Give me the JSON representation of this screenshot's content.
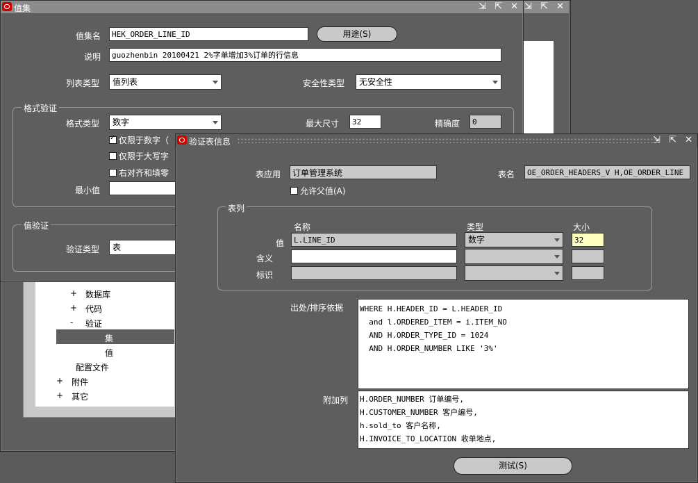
{
  "bg_window": {
    "controls": "⇲ ⇱ ✕"
  },
  "valueset": {
    "title": "值集",
    "controls": "⇲ ⇱ ✕",
    "name_label": "值集名",
    "name_value": "HEK_ORDER_LINE_ID",
    "usage_button": "用途(S)",
    "desc_label": "说明",
    "desc_value": "guozhenbin 20100421 2%字单增加3%订单的行信息",
    "list_type_label": "列表类型",
    "list_type_value": "值列表",
    "security_label": "安全性类型",
    "security_value": "无安全性",
    "format_group": "格式验证",
    "format_type_label": "格式类型",
    "format_type_value": "数字",
    "max_size_label": "最大尺寸",
    "max_size_value": "32",
    "precision_label": "精确度",
    "precision_value": "0",
    "chk_numbers_only": "仅限于数字（",
    "chk_uppercase": "仅限于大写字",
    "chk_right_justify": "右对齐和填零",
    "min_label": "最小值",
    "value_group": "值验证",
    "validation_type_label": "验证类型",
    "validation_type_value": "表"
  },
  "tree": {
    "items": [
      "数据库",
      "代码",
      "验证",
      "集",
      "值",
      "配置文件",
      "附件",
      "其它"
    ],
    "expanders": [
      "+",
      "+",
      "-",
      "+",
      "+"
    ]
  },
  "tableinfo": {
    "title": "验证表信息",
    "controls": "⇲ ⇱ ✕",
    "app_label": "表应用",
    "app_value": "订单管理系统",
    "table_label": "表名",
    "table_value": "OE_ORDER_HEADERS_V H,OE_ORDER_LINE",
    "allow_parent": "允许父值(A)",
    "columns_group": "表列",
    "col_name_header": "名称",
    "col_type_header": "类型",
    "col_size_header": "大小",
    "row_value_label": "值",
    "row_value_name": "L.LINE_ID",
    "row_value_type": "数字",
    "row_value_size": "32",
    "row_meaning_label": "含义",
    "row_id_label": "标识",
    "where_label": "出处/排序依据",
    "where_lines": [
      "WHERE H.HEADER_ID = L.HEADER_ID",
      "  and l.ORDERED_ITEM = i.ITEM_NO",
      "  AND H.ORDER_TYPE_ID = 1024",
      "  AND H.ORDER_NUMBER LIKE '3%'"
    ],
    "extra_label": "附加列",
    "extra_lines": [
      "H.ORDER_NUMBER 订单编号,",
      "H.CUSTOMER_NUMBER 客户编号,",
      "h.sold_to 客户名称,",
      "H.INVOICE_TO_LOCATION 收单地点,"
    ],
    "test_button": "测试(S)"
  }
}
